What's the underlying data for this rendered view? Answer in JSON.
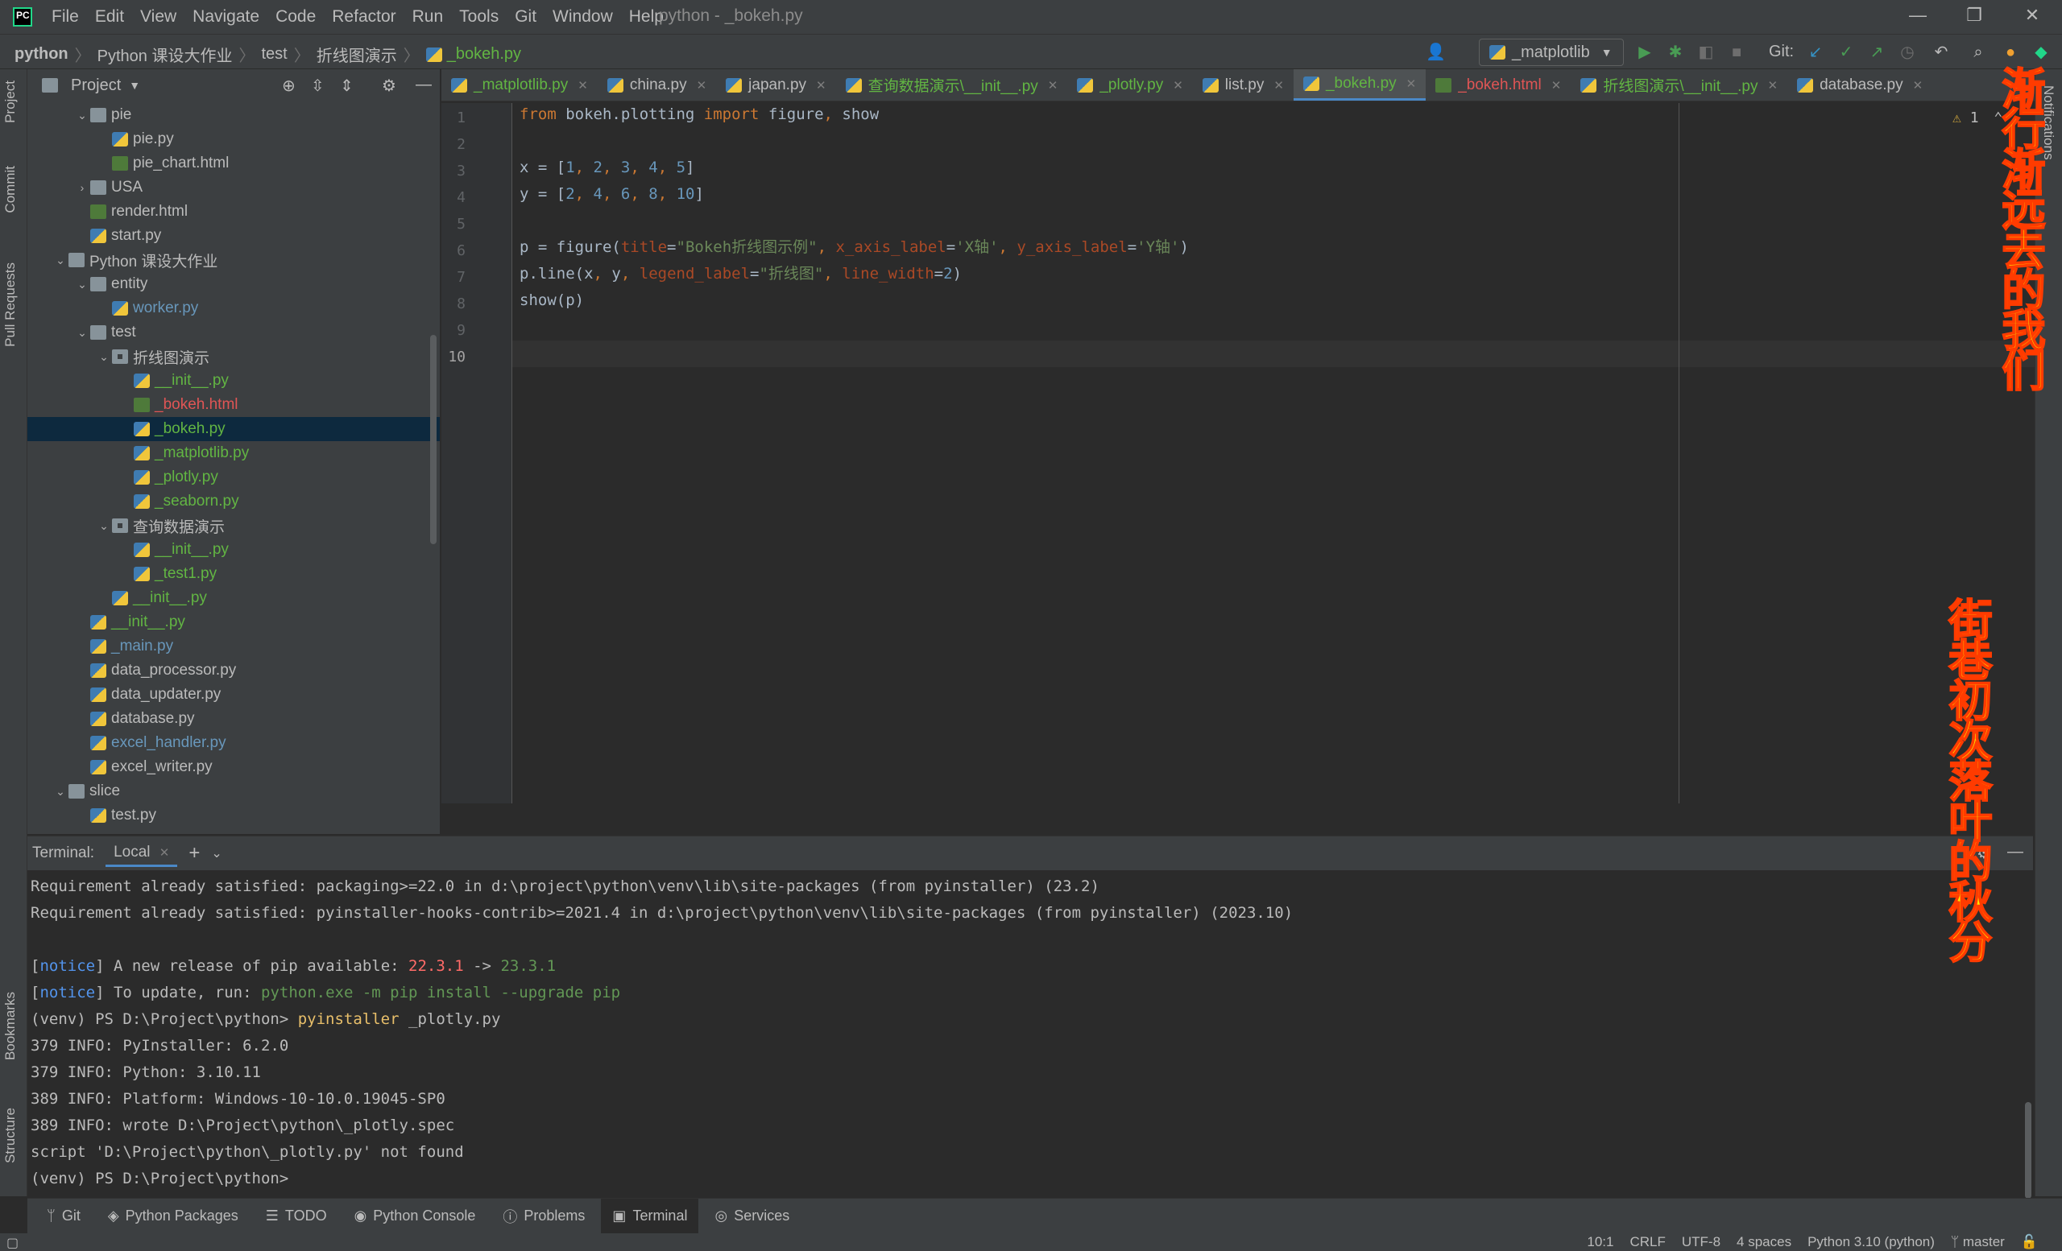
{
  "window": {
    "title": "python - _bokeh.py",
    "menu": [
      "File",
      "Edit",
      "View",
      "Navigate",
      "Code",
      "Refactor",
      "Run",
      "Tools",
      "Git",
      "Window",
      "Help"
    ]
  },
  "navbar": {
    "breadcrumb": [
      "python",
      "Python 课设大作业",
      "test",
      "折线图演示",
      "_bokeh.py"
    ],
    "run_config": "_matplotlib",
    "git_label": "Git:"
  },
  "left_strip": [
    "Project",
    "Commit",
    "Pull Requests",
    "Bookmarks",
    "Structure"
  ],
  "right_strip": [
    "Notifications"
  ],
  "project_panel": {
    "title": "Project",
    "tree": [
      {
        "label": "pie",
        "depth": 3,
        "type": "folder",
        "expanded": true,
        "color": ""
      },
      {
        "label": "pie.py",
        "depth": 4,
        "type": "py",
        "color": ""
      },
      {
        "label": "pie_chart.html",
        "depth": 4,
        "type": "html",
        "color": ""
      },
      {
        "label": "USA",
        "depth": 3,
        "type": "folder",
        "expanded": false,
        "color": ""
      },
      {
        "label": "render.html",
        "depth": 3,
        "type": "html",
        "color": ""
      },
      {
        "label": "start.py",
        "depth": 3,
        "type": "py",
        "color": ""
      },
      {
        "label": "Python 课设大作业",
        "depth": 2,
        "type": "folder",
        "expanded": true,
        "color": ""
      },
      {
        "label": "entity",
        "depth": 3,
        "type": "folder",
        "expanded": true,
        "color": ""
      },
      {
        "label": "worker.py",
        "depth": 4,
        "type": "py",
        "color": "blue"
      },
      {
        "label": "test",
        "depth": 3,
        "type": "folder",
        "expanded": true,
        "color": ""
      },
      {
        "label": "折线图演示",
        "depth": 4,
        "type": "pkg",
        "expanded": true,
        "color": ""
      },
      {
        "label": "__init__.py",
        "depth": 5,
        "type": "py",
        "color": "green"
      },
      {
        "label": "_bokeh.html",
        "depth": 5,
        "type": "html",
        "color": "red"
      },
      {
        "label": "_bokeh.py",
        "depth": 5,
        "type": "py",
        "color": "green",
        "selected": true
      },
      {
        "label": "_matplotlib.py",
        "depth": 5,
        "type": "py",
        "color": "green"
      },
      {
        "label": "_plotly.py",
        "depth": 5,
        "type": "py",
        "color": "green"
      },
      {
        "label": "_seaborn.py",
        "depth": 5,
        "type": "py",
        "color": "green"
      },
      {
        "label": "查询数据演示",
        "depth": 4,
        "type": "pkg",
        "expanded": true,
        "color": ""
      },
      {
        "label": "__init__.py",
        "depth": 5,
        "type": "py",
        "color": "green"
      },
      {
        "label": "_test1.py",
        "depth": 5,
        "type": "py",
        "color": "green"
      },
      {
        "label": "__init__.py",
        "depth": 4,
        "type": "py",
        "color": "green"
      },
      {
        "label": "__init__.py",
        "depth": 3,
        "type": "py",
        "color": "green"
      },
      {
        "label": "_main.py",
        "depth": 3,
        "type": "py",
        "color": "blue"
      },
      {
        "label": "data_processor.py",
        "depth": 3,
        "type": "py",
        "color": ""
      },
      {
        "label": "data_updater.py",
        "depth": 3,
        "type": "py",
        "color": ""
      },
      {
        "label": "database.py",
        "depth": 3,
        "type": "py",
        "color": ""
      },
      {
        "label": "excel_handler.py",
        "depth": 3,
        "type": "py",
        "color": "blue"
      },
      {
        "label": "excel_writer.py",
        "depth": 3,
        "type": "py",
        "color": ""
      },
      {
        "label": "slice",
        "depth": 2,
        "type": "folder",
        "expanded": true,
        "color": ""
      },
      {
        "label": "test.py",
        "depth": 3,
        "type": "py",
        "color": ""
      }
    ]
  },
  "editor_tabs": [
    {
      "label": "_matplotlib.py",
      "color": "green",
      "icon": "python-file-icon"
    },
    {
      "label": "china.py",
      "color": "",
      "icon": "python-file-icon"
    },
    {
      "label": "japan.py",
      "color": "",
      "icon": "python-file-icon"
    },
    {
      "label": "查询数据演示\\__init__.py",
      "color": "green",
      "icon": "python-file-icon"
    },
    {
      "label": "_plotly.py",
      "color": "green",
      "icon": "python-file-icon"
    },
    {
      "label": "list.py",
      "color": "",
      "icon": "python-file-icon"
    },
    {
      "label": "_bokeh.py",
      "color": "green",
      "icon": "python-file-icon",
      "active": true
    },
    {
      "label": "_bokeh.html",
      "color": "red",
      "icon": "html-file-icon"
    },
    {
      "label": "折线图演示\\__init__.py",
      "color": "green",
      "icon": "python-file-icon"
    },
    {
      "label": "database.py",
      "color": "",
      "icon": "python-file-icon"
    }
  ],
  "editor": {
    "warning_count": "1",
    "line_numbers": [
      "1",
      "2",
      "3",
      "4",
      "5",
      "6",
      "7",
      "8",
      "9",
      "10"
    ],
    "lines": [
      [
        {
          "t": "from",
          "c": "kw"
        },
        {
          "t": " bokeh.plotting ",
          "c": ""
        },
        {
          "t": "import",
          "c": "kw"
        },
        {
          "t": " figure",
          "c": ""
        },
        {
          "t": ",",
          "c": "kw"
        },
        {
          "t": " show",
          "c": ""
        }
      ],
      [],
      [
        {
          "t": "x = [",
          "c": ""
        },
        {
          "t": "1",
          "c": "num"
        },
        {
          "t": ", ",
          "c": "kw"
        },
        {
          "t": "2",
          "c": "num"
        },
        {
          "t": ", ",
          "c": "kw"
        },
        {
          "t": "3",
          "c": "num"
        },
        {
          "t": ", ",
          "c": "kw"
        },
        {
          "t": "4",
          "c": "num"
        },
        {
          "t": ", ",
          "c": "kw"
        },
        {
          "t": "5",
          "c": "num"
        },
        {
          "t": "]",
          "c": ""
        }
      ],
      [
        {
          "t": "y = [",
          "c": ""
        },
        {
          "t": "2",
          "c": "num"
        },
        {
          "t": ", ",
          "c": "kw"
        },
        {
          "t": "4",
          "c": "num"
        },
        {
          "t": ", ",
          "c": "kw"
        },
        {
          "t": "6",
          "c": "num"
        },
        {
          "t": ", ",
          "c": "kw"
        },
        {
          "t": "8",
          "c": "num"
        },
        {
          "t": ", ",
          "c": "kw"
        },
        {
          "t": "10",
          "c": "num"
        },
        {
          "t": "]",
          "c": ""
        }
      ],
      [],
      [
        {
          "t": "p = figure(",
          "c": ""
        },
        {
          "t": "title",
          "c": "prm"
        },
        {
          "t": "=",
          "c": ""
        },
        {
          "t": "\"Bokeh折线图示例\"",
          "c": "str"
        },
        {
          "t": ", ",
          "c": "kw"
        },
        {
          "t": "x_axis_label",
          "c": "prm"
        },
        {
          "t": "=",
          "c": ""
        },
        {
          "t": "'X轴'",
          "c": "str"
        },
        {
          "t": ", ",
          "c": "kw"
        },
        {
          "t": "y_axis_label",
          "c": "prm"
        },
        {
          "t": "=",
          "c": ""
        },
        {
          "t": "'Y轴'",
          "c": "str"
        },
        {
          "t": ")",
          "c": ""
        }
      ],
      [
        {
          "t": "p.line(x",
          "c": ""
        },
        {
          "t": ", ",
          "c": "kw"
        },
        {
          "t": "y",
          "c": ""
        },
        {
          "t": ", ",
          "c": "kw"
        },
        {
          "t": "legend_label",
          "c": "prm"
        },
        {
          "t": "=",
          "c": ""
        },
        {
          "t": "\"折线图\"",
          "c": "str"
        },
        {
          "t": ", ",
          "c": "kw"
        },
        {
          "t": "line_width",
          "c": "prm"
        },
        {
          "t": "=",
          "c": ""
        },
        {
          "t": "2",
          "c": "num"
        },
        {
          "t": ")",
          "c": ""
        }
      ],
      [
        {
          "t": "show(p)",
          "c": ""
        }
      ],
      [],
      []
    ]
  },
  "terminal": {
    "title": "Terminal:",
    "tab": "Local",
    "lines": [
      [
        {
          "t": "Requirement already satisfied: packaging>=22.0 in d:\\project\\python\\venv\\lib\\site-packages (from pyinstaller) (23.2)",
          "c": ""
        }
      ],
      [
        {
          "t": "Requirement already satisfied: pyinstaller-hooks-contrib>=2021.4 in d:\\project\\python\\venv\\lib\\site-packages (from pyinstaller) (2023.10)",
          "c": ""
        }
      ],
      [],
      [
        {
          "t": "[",
          "c": ""
        },
        {
          "t": "notice",
          "c": "t-blue"
        },
        {
          "t": "] A new release of pip available: ",
          "c": ""
        },
        {
          "t": "22.3.1",
          "c": "t-red"
        },
        {
          "t": " -> ",
          "c": ""
        },
        {
          "t": "23.3.1",
          "c": "t-green"
        }
      ],
      [
        {
          "t": "[",
          "c": ""
        },
        {
          "t": "notice",
          "c": "t-blue"
        },
        {
          "t": "] To update, run: ",
          "c": ""
        },
        {
          "t": "python.exe -m pip install --upgrade pip",
          "c": "t-green"
        }
      ],
      [
        {
          "t": "(venv) PS D:\\Project\\python> ",
          "c": ""
        },
        {
          "t": "pyinstaller",
          "c": "t-yellow"
        },
        {
          "t": " _plotly.py",
          "c": ""
        }
      ],
      [
        {
          "t": "379 INFO: PyInstaller: 6.2.0",
          "c": ""
        }
      ],
      [
        {
          "t": "379 INFO: Python: 3.10.11",
          "c": ""
        }
      ],
      [
        {
          "t": "389 INFO: Platform: Windows-10-10.0.19045-SP0",
          "c": ""
        }
      ],
      [
        {
          "t": "389 INFO: wrote D:\\Project\\python\\_plotly.spec",
          "c": ""
        }
      ],
      [
        {
          "t": "script 'D:\\Project\\python\\_plotly.py' not found",
          "c": ""
        }
      ],
      [
        {
          "t": "(venv) PS D:\\Project\\python>",
          "c": ""
        }
      ]
    ]
  },
  "bottom_tools": [
    {
      "label": "Git",
      "icon": "git-branch-icon"
    },
    {
      "label": "Python Packages",
      "icon": "packages-icon"
    },
    {
      "label": "TODO",
      "icon": "list-icon"
    },
    {
      "label": "Python Console",
      "icon": "python-console-icon"
    },
    {
      "label": "Problems",
      "icon": "problems-icon"
    },
    {
      "label": "Terminal",
      "icon": "terminal-icon",
      "active": true
    },
    {
      "label": "Services",
      "icon": "services-icon"
    }
  ],
  "statusbar": {
    "position": "10:1",
    "line_sep": "CRLF",
    "encoding": "UTF-8",
    "indent": "4 spaces",
    "interpreter": "Python 3.10 (python)",
    "branch": "master"
  },
  "overlay_text": {
    "top": "渐行渐远去的我们",
    "bottom": "街巷初次落叶的秋分"
  },
  "colors": {
    "accent": "#4a88c7",
    "file_green": "#62b543",
    "file_blue": "#6897bb",
    "file_red": "#e05555",
    "overlay_fill": "#ffe800",
    "overlay_stroke": "#ff3b00"
  }
}
